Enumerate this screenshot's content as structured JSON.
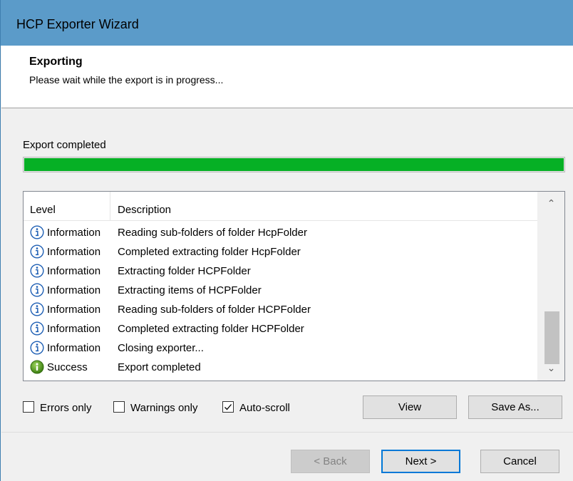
{
  "window": {
    "title": "HCP Exporter Wizard"
  },
  "header": {
    "title": "Exporting",
    "subtitle": "Please wait while the export is in progress..."
  },
  "progress": {
    "label": "Export completed",
    "value_percent": 100,
    "color": "#06b025"
  },
  "log": {
    "columns": [
      "Level",
      "Description"
    ],
    "rows": [
      {
        "icon": "info-icon",
        "level": "Information",
        "description": "Reading sub-folders of folder HcpFolder"
      },
      {
        "icon": "info-icon",
        "level": "Information",
        "description": "Completed extracting folder HcpFolder"
      },
      {
        "icon": "info-icon",
        "level": "Information",
        "description": "Extracting folder HCPFolder"
      },
      {
        "icon": "info-icon",
        "level": "Information",
        "description": "Extracting items of HCPFolder"
      },
      {
        "icon": "info-icon",
        "level": "Information",
        "description": "Reading sub-folders of folder HCPFolder"
      },
      {
        "icon": "info-icon",
        "level": "Information",
        "description": "Completed extracting folder HCPFolder"
      },
      {
        "icon": "info-icon",
        "level": "Information",
        "description": "Closing exporter..."
      },
      {
        "icon": "success-icon",
        "level": "Success",
        "description": "Export completed"
      }
    ]
  },
  "filters": {
    "errors_only": {
      "label": "Errors only",
      "checked": false
    },
    "warnings_only": {
      "label": "Warnings only",
      "checked": false
    },
    "auto_scroll": {
      "label": "Auto-scroll",
      "checked": true
    }
  },
  "buttons": {
    "view": "View",
    "save_as": "Save As...",
    "back": "< Back",
    "next": "Next >",
    "cancel": "Cancel"
  },
  "colors": {
    "titlebar": "#5b9bc9",
    "accent": "#0078d7",
    "success": "#06b025"
  }
}
